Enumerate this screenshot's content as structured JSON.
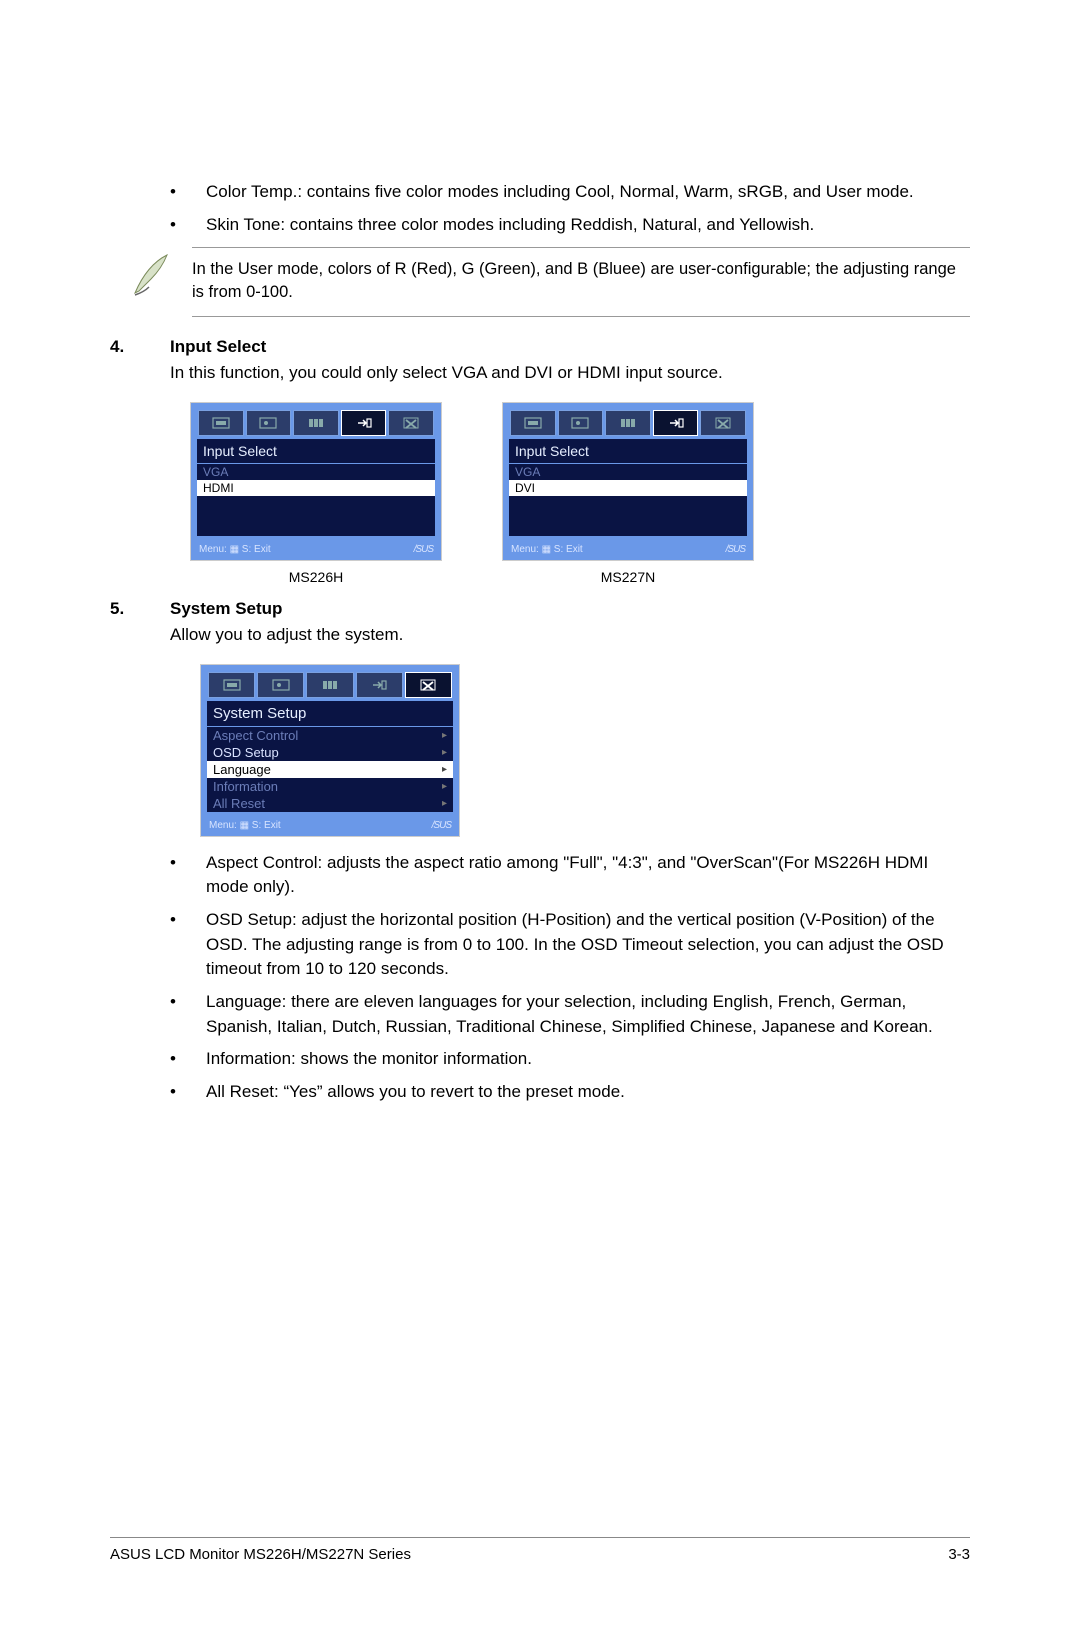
{
  "top_bullets": [
    "Color Temp.: contains five color modes including Cool, Normal, Warm, sRGB, and User mode.",
    "Skin Tone: contains three color modes including Reddish, Natural, and Yellowish."
  ],
  "note_text": "In the User mode, colors of R (Red), G (Green), and B (Bluee) are user-configurable; the adjusting range is from 0-100.",
  "section4": {
    "num": "4.",
    "title": "Input Select",
    "desc": "In this function, you could only select  VGA  and DVI or HDMI input source."
  },
  "osd1": {
    "title": "Input Select",
    "items": [
      {
        "label": "VGA",
        "state": "dim"
      },
      {
        "label": "HDMI",
        "state": "sel"
      }
    ],
    "footer_left": "Menu: ▦   S: Exit",
    "footer_right": "/SUS",
    "caption": "MS226H"
  },
  "osd2": {
    "title": "Input Select",
    "items": [
      {
        "label": "VGA",
        "state": "dim"
      },
      {
        "label": "DVI",
        "state": "sel"
      }
    ],
    "footer_left": "Menu: ▦   S: Exit",
    "footer_right": "/SUS",
    "caption": "MS227N"
  },
  "section5": {
    "num": "5.",
    "title": "System Setup",
    "desc": "Allow you to adjust the system."
  },
  "osd3": {
    "title": "System Setup",
    "items": [
      {
        "label": "Aspect Control",
        "state": "dim",
        "chev": true
      },
      {
        "label": "OSD Setup",
        "state": "available",
        "chev": true
      },
      {
        "label": "Language",
        "state": "sel",
        "chev": true
      },
      {
        "label": "Information",
        "state": "dim",
        "chev": true
      },
      {
        "label": "All Reset",
        "state": "dim",
        "chev": true
      }
    ],
    "footer_left": "Menu: ▦   S: Exit",
    "footer_right": "/SUS"
  },
  "bottom_bullets": [
    "Aspect Control: adjusts the aspect ratio among \"Full\", \"4:3\", and \"OverScan\"(For MS226H HDMI mode only).",
    "OSD Setup: adjust the horizontal position (H-Position) and the vertical position (V-Position) of the OSD. The adjusting range is from 0 to 100. In the OSD Timeout selection, you can adjust the OSD timeout from 10 to 120 seconds.",
    "Language: there are eleven languages for your selection, including English, French, German, Spanish, Italian, Dutch, Russian, Traditional Chinese, Simplified Chinese, Japanese and Korean.",
    "Information: shows the monitor information.",
    "All Reset: “Yes” allows you to revert to the preset mode."
  ],
  "footer": {
    "left": "ASUS LCD Monitor MS226H/MS227N Series",
    "right": "3-3"
  },
  "bullet_glyph": "•"
}
